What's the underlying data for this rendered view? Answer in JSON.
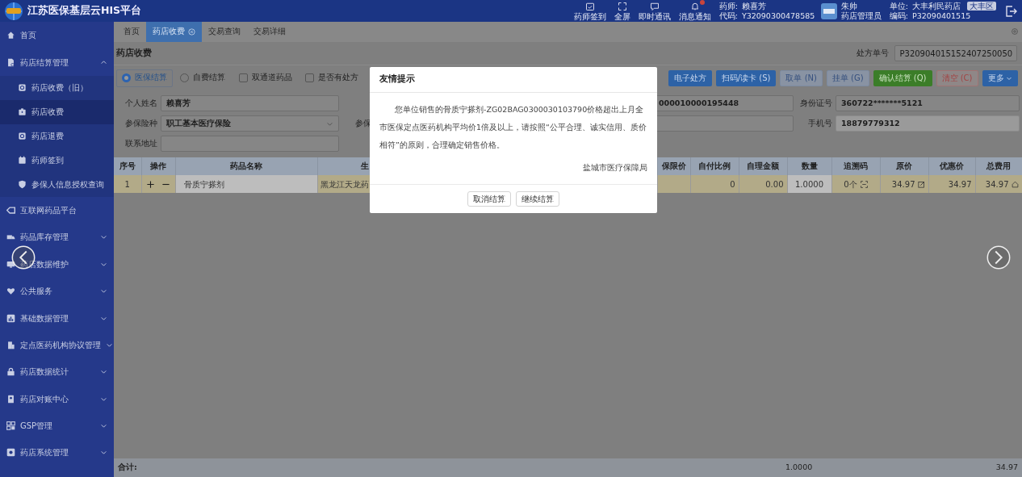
{
  "header": {
    "title": "江苏医保基层云HIS平台",
    "tools": [
      {
        "label": "药师签到",
        "badge": false
      },
      {
        "label": "全屏",
        "badge": false
      },
      {
        "label": "即时通讯",
        "badge": false
      },
      {
        "label": "消息通知",
        "badge": true
      }
    ],
    "pharmacist": {
      "name_label": "药师:",
      "name": "赖喜芳",
      "code_label": "代码:",
      "code": "Y32090300478585"
    },
    "user": {
      "name": "朱帅",
      "role": "药店管理员"
    },
    "unit": {
      "name_label": "单位:",
      "name": "大丰利民药店",
      "district": "大丰区",
      "code_label": "编码:",
      "code": "P32090401515"
    }
  },
  "sidebar": {
    "items": [
      {
        "label": "首页",
        "selected": false
      },
      {
        "label": "药店结算管理",
        "selected": false,
        "expanded": true,
        "children": [
          {
            "label": "药店收费（旧）",
            "selected": false
          },
          {
            "label": "药店收费",
            "selected": true
          },
          {
            "label": "药店退费",
            "selected": false
          },
          {
            "label": "药师签到",
            "selected": false
          },
          {
            "label": "参保人信息授权查询",
            "selected": false
          }
        ]
      },
      {
        "label": "互联网药品平台",
        "selected": false
      },
      {
        "label": "药品库存管理",
        "selected": false,
        "expanded": false
      },
      {
        "label": "药店数据维护",
        "selected": false,
        "expanded": false
      },
      {
        "label": "公共服务",
        "selected": false,
        "expanded": false
      },
      {
        "label": "基础数据管理",
        "selected": false,
        "expanded": false
      },
      {
        "label": "定点医药机构协议管理",
        "selected": false,
        "expanded": false
      },
      {
        "label": "药店数据统计",
        "selected": false,
        "expanded": false
      },
      {
        "label": "药店对账中心",
        "selected": false,
        "expanded": false
      },
      {
        "label": "GSP管理",
        "selected": false,
        "expanded": false
      },
      {
        "label": "药店系统管理",
        "selected": false,
        "expanded": false
      }
    ]
  },
  "tabs": [
    {
      "label": "首页",
      "selected": false,
      "closable": false
    },
    {
      "label": "药店收费",
      "selected": true,
      "closable": true
    },
    {
      "label": "交易查询",
      "selected": false,
      "closable": false
    },
    {
      "label": "交易详细",
      "selected": false,
      "closable": false
    }
  ],
  "page_title": "药店收费",
  "prescription": {
    "label": "处方单号",
    "value": "P320904015152407250050"
  },
  "options": [
    {
      "kind": "radio",
      "label": "医保结算",
      "selected": true
    },
    {
      "kind": "radio",
      "label": "自费结算",
      "selected": false
    },
    {
      "kind": "checkbox",
      "label": "双通道药品",
      "checked": false
    },
    {
      "kind": "checkbox",
      "label": "是否有处方",
      "checked": false
    }
  ],
  "actions": [
    {
      "label": "电子处方",
      "kind": "primary"
    },
    {
      "label": "扫码/读卡 (S)",
      "kind": "primary"
    },
    {
      "label": "取单 (N)",
      "kind": "plain"
    },
    {
      "label": "挂单 (G)",
      "kind": "plain"
    },
    {
      "label": "确认结算 (Q)",
      "kind": "success"
    },
    {
      "label": "清空 (C)",
      "kind": "danger"
    },
    {
      "label": "更多",
      "kind": "dropdown"
    }
  ],
  "form": [
    {
      "left": {
        "label": "个人姓名",
        "kind": "input",
        "value": "赖喜芳"
      },
      "middle": {
        "kind": "input",
        "value": "000010000195448"
      },
      "right": {
        "label": "身份证号",
        "kind": "input",
        "value": "360722*******5121",
        "disabled": false
      }
    },
    {
      "left": {
        "label": "参保险种",
        "kind": "select",
        "value": "职工基本医疗保险"
      },
      "middle": {
        "label": "参保",
        "kind": "input"
      },
      "right": {
        "label": "手机号",
        "kind": "input",
        "value": "18879779312",
        "disabled": true
      }
    },
    {
      "left": {
        "label": "联系地址",
        "kind": "input"
      }
    }
  ],
  "table": {
    "columns": [
      "序号",
      "操作",
      "药品名称",
      "生",
      "保限价",
      "自付比例",
      "自理金额",
      "数量",
      "追溯码",
      "原价",
      "优惠价",
      "总费用"
    ],
    "rows": [
      {
        "index": "1",
        "name": "骨质宁搽剂",
        "maker": "黑龙江天龙药",
        "self_ratio": "0",
        "self_amount": "0.00",
        "quantity": "1.0000",
        "trace": "0个",
        "price": "34.97",
        "discount_price": "34.97",
        "total": "34.97"
      }
    ],
    "footer": {
      "label": "合计:",
      "quantity": "1.0000",
      "total": "34.97"
    }
  },
  "dialog": {
    "title": "友情提示",
    "message": "您单位销售的骨质宁搽剂-ZG02BAG0300030103790价格超出上月全市医保定点医药机构平均价1倍及以上，请按照“公平合理、诚实信用、质价相符”的原则，合理确定销售价格。",
    "signature": "盐城市医疗保障局",
    "buttons": [
      "取消结算",
      "继续结算"
    ]
  }
}
